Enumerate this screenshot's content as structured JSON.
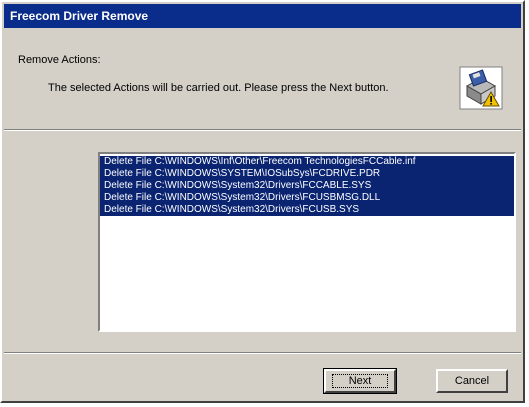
{
  "window": {
    "title": "Freecom Driver Remove"
  },
  "header": {
    "section_label": "Remove Actions:",
    "description": "The selected Actions will be carried out. Please press the Next button.",
    "icon": "installer-remove-icon"
  },
  "actions_list": {
    "items": [
      "Delete File C:\\WINDOWS\\Inf\\Other\\Freecom TechnologiesFCCable.inf",
      "Delete File C:\\WINDOWS\\SYSTEM\\IOSubSys\\FCDRIVE.PDR",
      "Delete File C:\\WINDOWS\\System32\\Drivers\\FCCABLE.SYS",
      "Delete File C:\\WINDOWS\\System32\\Drivers\\FCUSBMSG.DLL",
      "Delete File C:\\WINDOWS\\System32\\Drivers\\FCUSB.SYS"
    ]
  },
  "buttons": {
    "next_label": "Next",
    "cancel_label": "Cancel"
  },
  "colors": {
    "titlebar": "#0a2c8a",
    "selection": "#0a2472",
    "face": "#d4d0c8"
  }
}
